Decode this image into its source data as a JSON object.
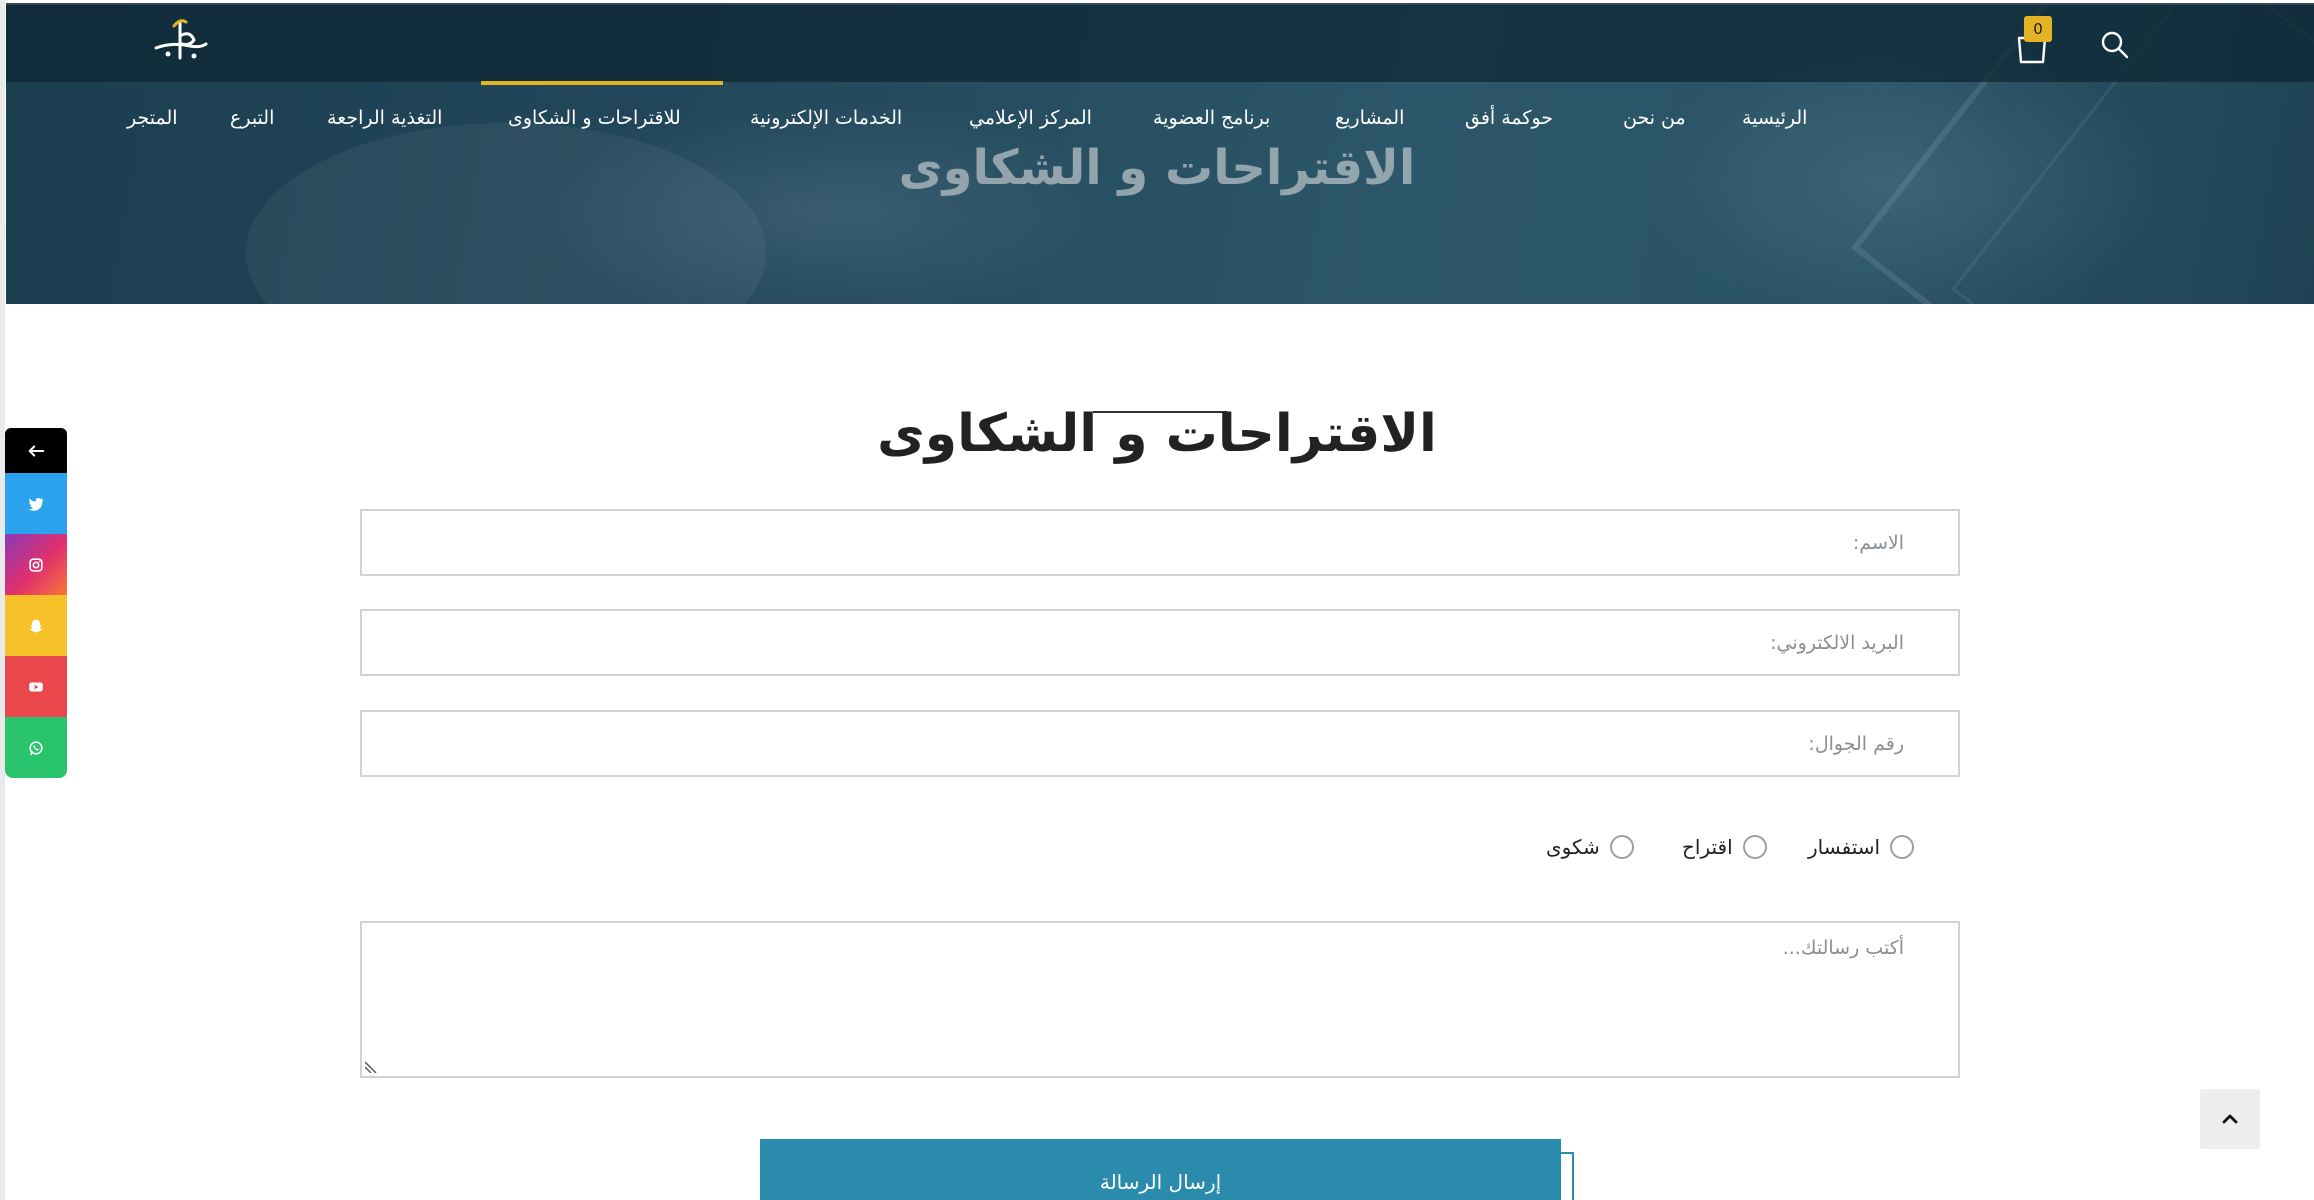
{
  "header": {
    "cart_count": "0",
    "nav": [
      {
        "id": "home",
        "label": "الرئيسية"
      },
      {
        "id": "about",
        "label": "من نحن"
      },
      {
        "id": "governance",
        "label": "حوكمة أفق"
      },
      {
        "id": "projects",
        "label": "المشاريع"
      },
      {
        "id": "membership",
        "label": "برنامج العضوية"
      },
      {
        "id": "media",
        "label": "المركز الإعلامي"
      },
      {
        "id": "eservices",
        "label": "الخدمات الإلكترونية"
      },
      {
        "id": "complaints",
        "label": "للاقتراحات و الشكاوى",
        "active": true
      },
      {
        "id": "feedback",
        "label": "التغذية الراجعة"
      },
      {
        "id": "donate",
        "label": "التبرع"
      },
      {
        "id": "store",
        "label": "المتجر"
      }
    ]
  },
  "hero": {
    "title": "الاقتراحات و الشكاوى"
  },
  "social": {
    "toggle": "back-arrow-icon",
    "items": [
      "twitter-icon",
      "instagram-icon",
      "snapchat-icon",
      "youtube-icon",
      "whatsapp-icon"
    ]
  },
  "form": {
    "title": "الاقتراحات و الشكاوى",
    "name_placeholder": "الاسم:",
    "email_placeholder": "البريد الالكتروني:",
    "phone_placeholder": "رقم الجوال:",
    "types": [
      {
        "id": "inquiry",
        "label": "استفسار"
      },
      {
        "id": "suggestion",
        "label": "اقتراح"
      },
      {
        "id": "complaint",
        "label": "شكوى"
      }
    ],
    "message_placeholder": "أكتب رسالتك...",
    "submit_label": "إرسال الرسالة"
  },
  "colors": {
    "accent": "#e4b324",
    "primary": "#2a8bad",
    "header_bg": "#1b3e50"
  }
}
